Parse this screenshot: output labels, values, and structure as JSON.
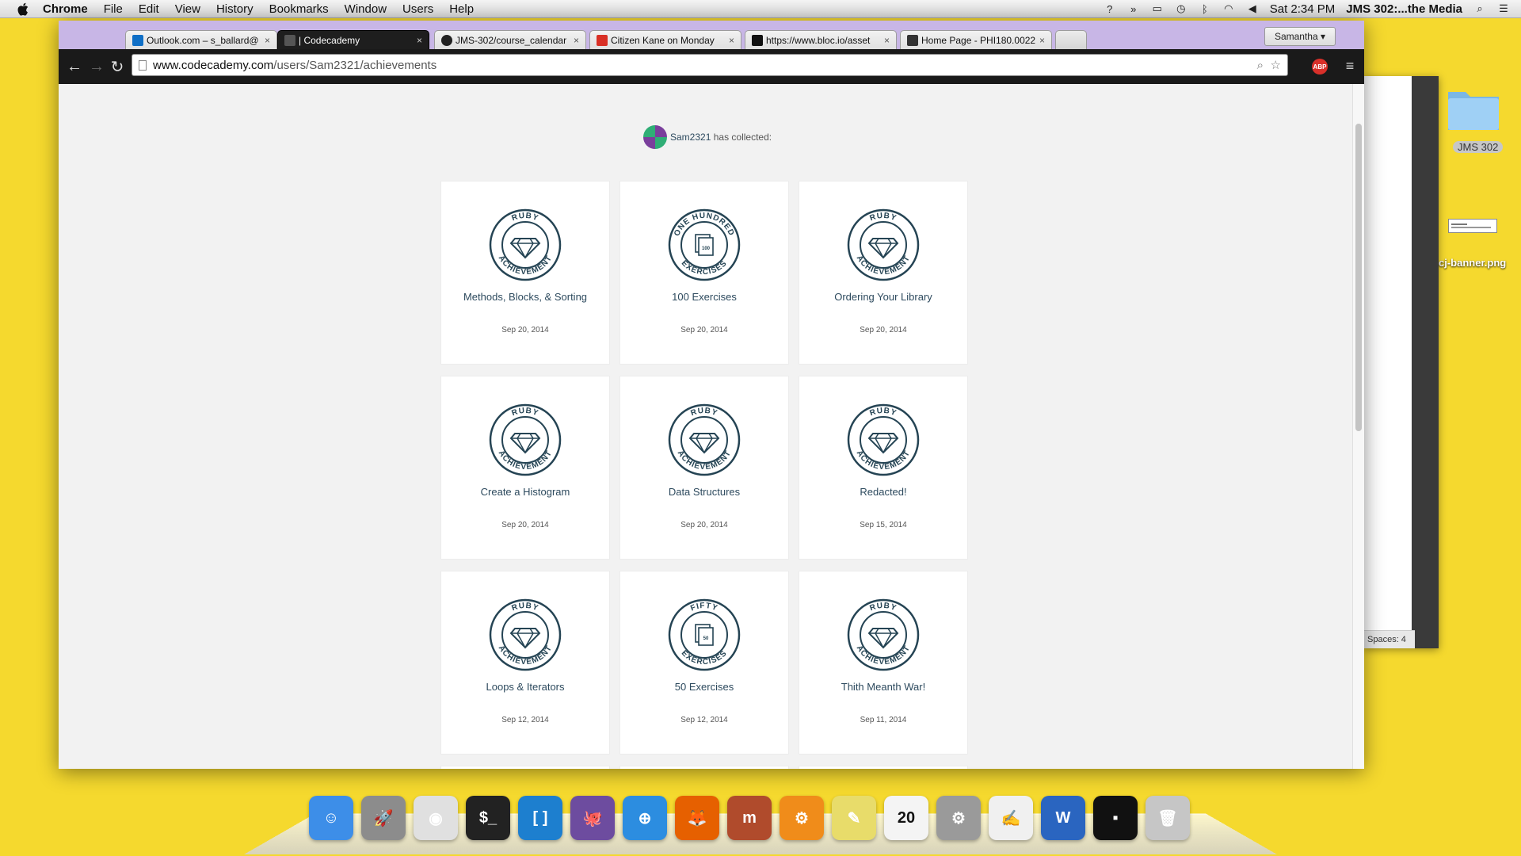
{
  "menubar": {
    "app_name": "Chrome",
    "items": [
      "File",
      "Edit",
      "View",
      "History",
      "Bookmarks",
      "Window",
      "Users",
      "Help"
    ],
    "clock": "Sat 2:34 PM",
    "window_title": "JMS 302:...the Media"
  },
  "desktop": {
    "folder_label": "JMS 302",
    "file_label": "cj-banner.png"
  },
  "editor": {
    "status_text": "Spaces: 4"
  },
  "browser": {
    "profile_name": "Samantha",
    "tabs": [
      {
        "label": "Outlook.com – s_ballard@",
        "color": "#0f6fc6"
      },
      {
        "label": "| Codecademy",
        "color": "#555555"
      },
      {
        "label": "JMS-302/course_calendar",
        "color": "#222222"
      },
      {
        "label": "Citizen Kane on Monday",
        "color": "#d93025"
      },
      {
        "label": "https://www.bloc.io/asset",
        "color": "#111111"
      },
      {
        "label": "Home Page - PHI180.0022",
        "color": "#333333"
      }
    ],
    "url_host": "www.codecademy.com",
    "url_path": "/users/Sam2321/achievements",
    "abp_label": "ABP"
  },
  "page": {
    "username": "Sam2321",
    "collected_text": "has collected:",
    "achievements": [
      {
        "title": "Methods, Blocks, & Sorting",
        "date": "Sep 20, 2014",
        "badge": "ruby-achievement-badge",
        "top_text": "RUBY",
        "bottom_text": "ACHIEVEMENT"
      },
      {
        "title": "100 Exercises",
        "date": "Sep 20, 2014",
        "badge": "one-hundred-exercises-badge",
        "top_text": "ONE HUNDRED",
        "bottom_text": "EXERCISES",
        "count": "100"
      },
      {
        "title": "Ordering Your Library",
        "date": "Sep 20, 2014",
        "badge": "ruby-achievement-badge",
        "top_text": "RUBY",
        "bottom_text": "ACHIEVEMENT"
      },
      {
        "title": "Create a Histogram",
        "date": "Sep 20, 2014",
        "badge": "ruby-achievement-badge",
        "top_text": "RUBY",
        "bottom_text": "ACHIEVEMENT"
      },
      {
        "title": "Data Structures",
        "date": "Sep 20, 2014",
        "badge": "ruby-achievement-badge",
        "top_text": "RUBY",
        "bottom_text": "ACHIEVEMENT"
      },
      {
        "title": "Redacted!",
        "date": "Sep 15, 2014",
        "badge": "ruby-achievement-badge",
        "top_text": "RUBY",
        "bottom_text": "ACHIEVEMENT"
      },
      {
        "title": "Loops & Iterators",
        "date": "Sep 12, 2014",
        "badge": "ruby-achievement-badge",
        "top_text": "RUBY",
        "bottom_text": "ACHIEVEMENT"
      },
      {
        "title": "50 Exercises",
        "date": "Sep 12, 2014",
        "badge": "fifty-exercises-badge",
        "top_text": "FIFTY",
        "bottom_text": "EXERCISES",
        "count": "50"
      },
      {
        "title": "Thith Meanth War!",
        "date": "Sep 11, 2014",
        "badge": "ruby-achievement-badge",
        "top_text": "RUBY",
        "bottom_text": "ACHIEVEMENT"
      }
    ]
  },
  "dock": {
    "apps": [
      {
        "name": "finder-icon",
        "color": "#3d8ee8",
        "glyph": "☺"
      },
      {
        "name": "launchpad-icon",
        "color": "#8c8c8c",
        "glyph": "🚀"
      },
      {
        "name": "chrome-icon",
        "color": "#e0e0e0",
        "glyph": "◉"
      },
      {
        "name": "terminal-icon",
        "color": "#222222",
        "glyph": "$_"
      },
      {
        "name": "brackets-icon",
        "color": "#1d7fcf",
        "glyph": "[ ]"
      },
      {
        "name": "github-icon",
        "color": "#6d4c9f",
        "glyph": "🐙"
      },
      {
        "name": "safari-icon",
        "color": "#2c8de0",
        "glyph": "⊕"
      },
      {
        "name": "firefox-icon",
        "color": "#e66000",
        "glyph": "🦊"
      },
      {
        "name": "text-wrangler-icon",
        "color": "#b04b2c",
        "glyph": "m"
      },
      {
        "name": "settings-gear-icon",
        "color": "#f08c1a",
        "glyph": "⚙"
      },
      {
        "name": "stickies-icon",
        "color": "#e8dc6a",
        "glyph": "✎"
      },
      {
        "name": "calendar-icon",
        "color": "#f4f4f4",
        "glyph": "20",
        "glyph_color": "#111"
      },
      {
        "name": "system-preferences-icon",
        "color": "#9a9a9a",
        "glyph": "⚙"
      },
      {
        "name": "textedit-icon",
        "color": "#f0f0f0",
        "glyph": "✍",
        "glyph_color": "#444"
      },
      {
        "name": "word-icon",
        "color": "#2a65c0",
        "glyph": "W"
      },
      {
        "name": "console-icon",
        "color": "#111111",
        "glyph": "▪"
      },
      {
        "name": "trash-icon",
        "color": "#c6c6c6",
        "glyph": "🗑"
      }
    ]
  }
}
